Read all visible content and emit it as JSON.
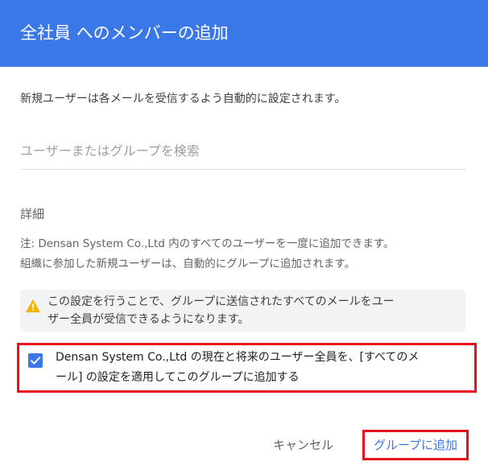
{
  "dialog": {
    "title": "全社員 へのメンバーの追加",
    "intro": "新規ユーザーは各メールを受信するよう自動的に設定されます。",
    "search": {
      "placeholder": "ユーザーまたはグループを検索",
      "value": ""
    },
    "details": {
      "title": "詳細",
      "note_line1": "注: Densan System Co.,Ltd 内のすべてのユーザーを一度に追加できます。",
      "note_line2": "組織に参加した新規ユーザーは、自動的にグループに追加されます。"
    },
    "warning": {
      "icon": "warning-triangle-icon",
      "text": "この設定を行うことで、グループに送信されたすべてのメールをユー\nザー全員が受信できるようになります。"
    },
    "checkbox": {
      "checked": true,
      "label": "Densan System Co.,Ltd の現在と将来のユーザー全員を、[すべてのメ\nール] の設定を適用してこのグループに追加する"
    },
    "actions": {
      "cancel_label": "キャンセル",
      "add_label": "グループに追加"
    }
  },
  "colors": {
    "header_bg": "#3b78e7",
    "accent": "#3b78e7",
    "highlight_border": "#e8101a",
    "warning_icon": "#f4b400",
    "warning_bg": "#f1f3f4"
  }
}
